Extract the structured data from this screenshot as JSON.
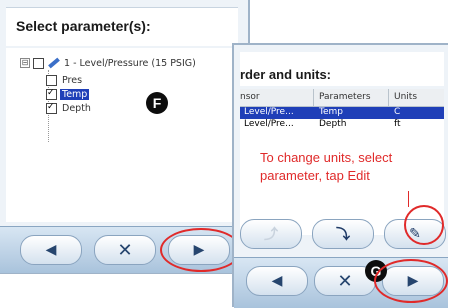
{
  "left_panel": {
    "title": "Select parameter(s):",
    "sensor": {
      "expander": "⊟",
      "label": "1 - Level/Pressure (15 PSIG)",
      "checked": false
    },
    "parameters": [
      {
        "label": "Pres",
        "checked": false,
        "selected": false
      },
      {
        "label": "Temp",
        "checked": true,
        "selected": true
      },
      {
        "label": "Depth",
        "checked": true,
        "selected": false
      }
    ],
    "marker": "F",
    "buttons": {
      "back": "back-arrow-icon",
      "cancel": "x-icon",
      "next": "next-arrow-icon"
    }
  },
  "right_panel": {
    "title_partial": "rder and units:",
    "columns": [
      "nsor",
      "Parameters",
      "Units"
    ],
    "rows": [
      {
        "sensor": "Level/Pre...",
        "parameter": "Temp",
        "unit": "C",
        "selected": true
      },
      {
        "sensor": "Level/Pre...",
        "parameter": "Depth",
        "unit": "ft",
        "selected": false
      }
    ],
    "annotation": "To change units, select parameter, tap Edit",
    "tools": {
      "up": "up-arrow-icon",
      "down": "down-arrow-icon",
      "edit": "edit-icon"
    },
    "marker": "G",
    "buttons": {
      "back": "back-arrow-icon",
      "cancel": "x-icon",
      "next": "next-arrow-icon"
    }
  },
  "colors": {
    "highlight": "#e02a2a",
    "selection": "#1f3fb8",
    "button_bar": "#a9c3dc"
  }
}
